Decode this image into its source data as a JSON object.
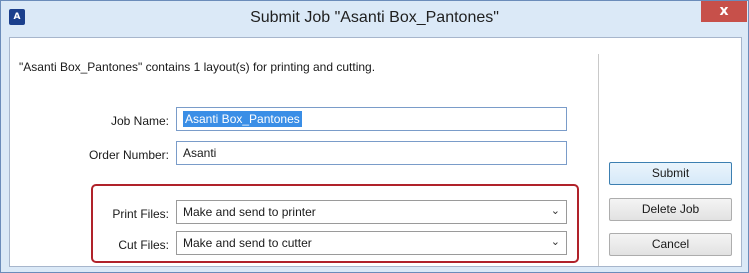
{
  "window": {
    "title": "Submit Job \"Asanti Box_Pantones\"",
    "app_icon_text": "A",
    "close_glyph": "x"
  },
  "info": {
    "text": "\"Asanti Box_Pantones\" contains 1 layout(s) for printing and cutting."
  },
  "form": {
    "job_name_label": "Job Name:",
    "job_name_value": "Asanti Box_Pantones",
    "order_number_label": "Order Number:",
    "order_number_value": "Asanti",
    "print_files_label": "Print Files:",
    "print_files_value": "Make and send to printer",
    "cut_files_label": "Cut Files:",
    "cut_files_value": "Make and send to cutter"
  },
  "buttons": {
    "submit": "Submit",
    "delete_job": "Delete Job",
    "cancel": "Cancel"
  },
  "icons": {
    "dropdown": "chevron-down-icon"
  },
  "colors": {
    "highlight_border": "#b0222a",
    "selection": "#3a8ee6",
    "close_button": "#c7504a"
  }
}
